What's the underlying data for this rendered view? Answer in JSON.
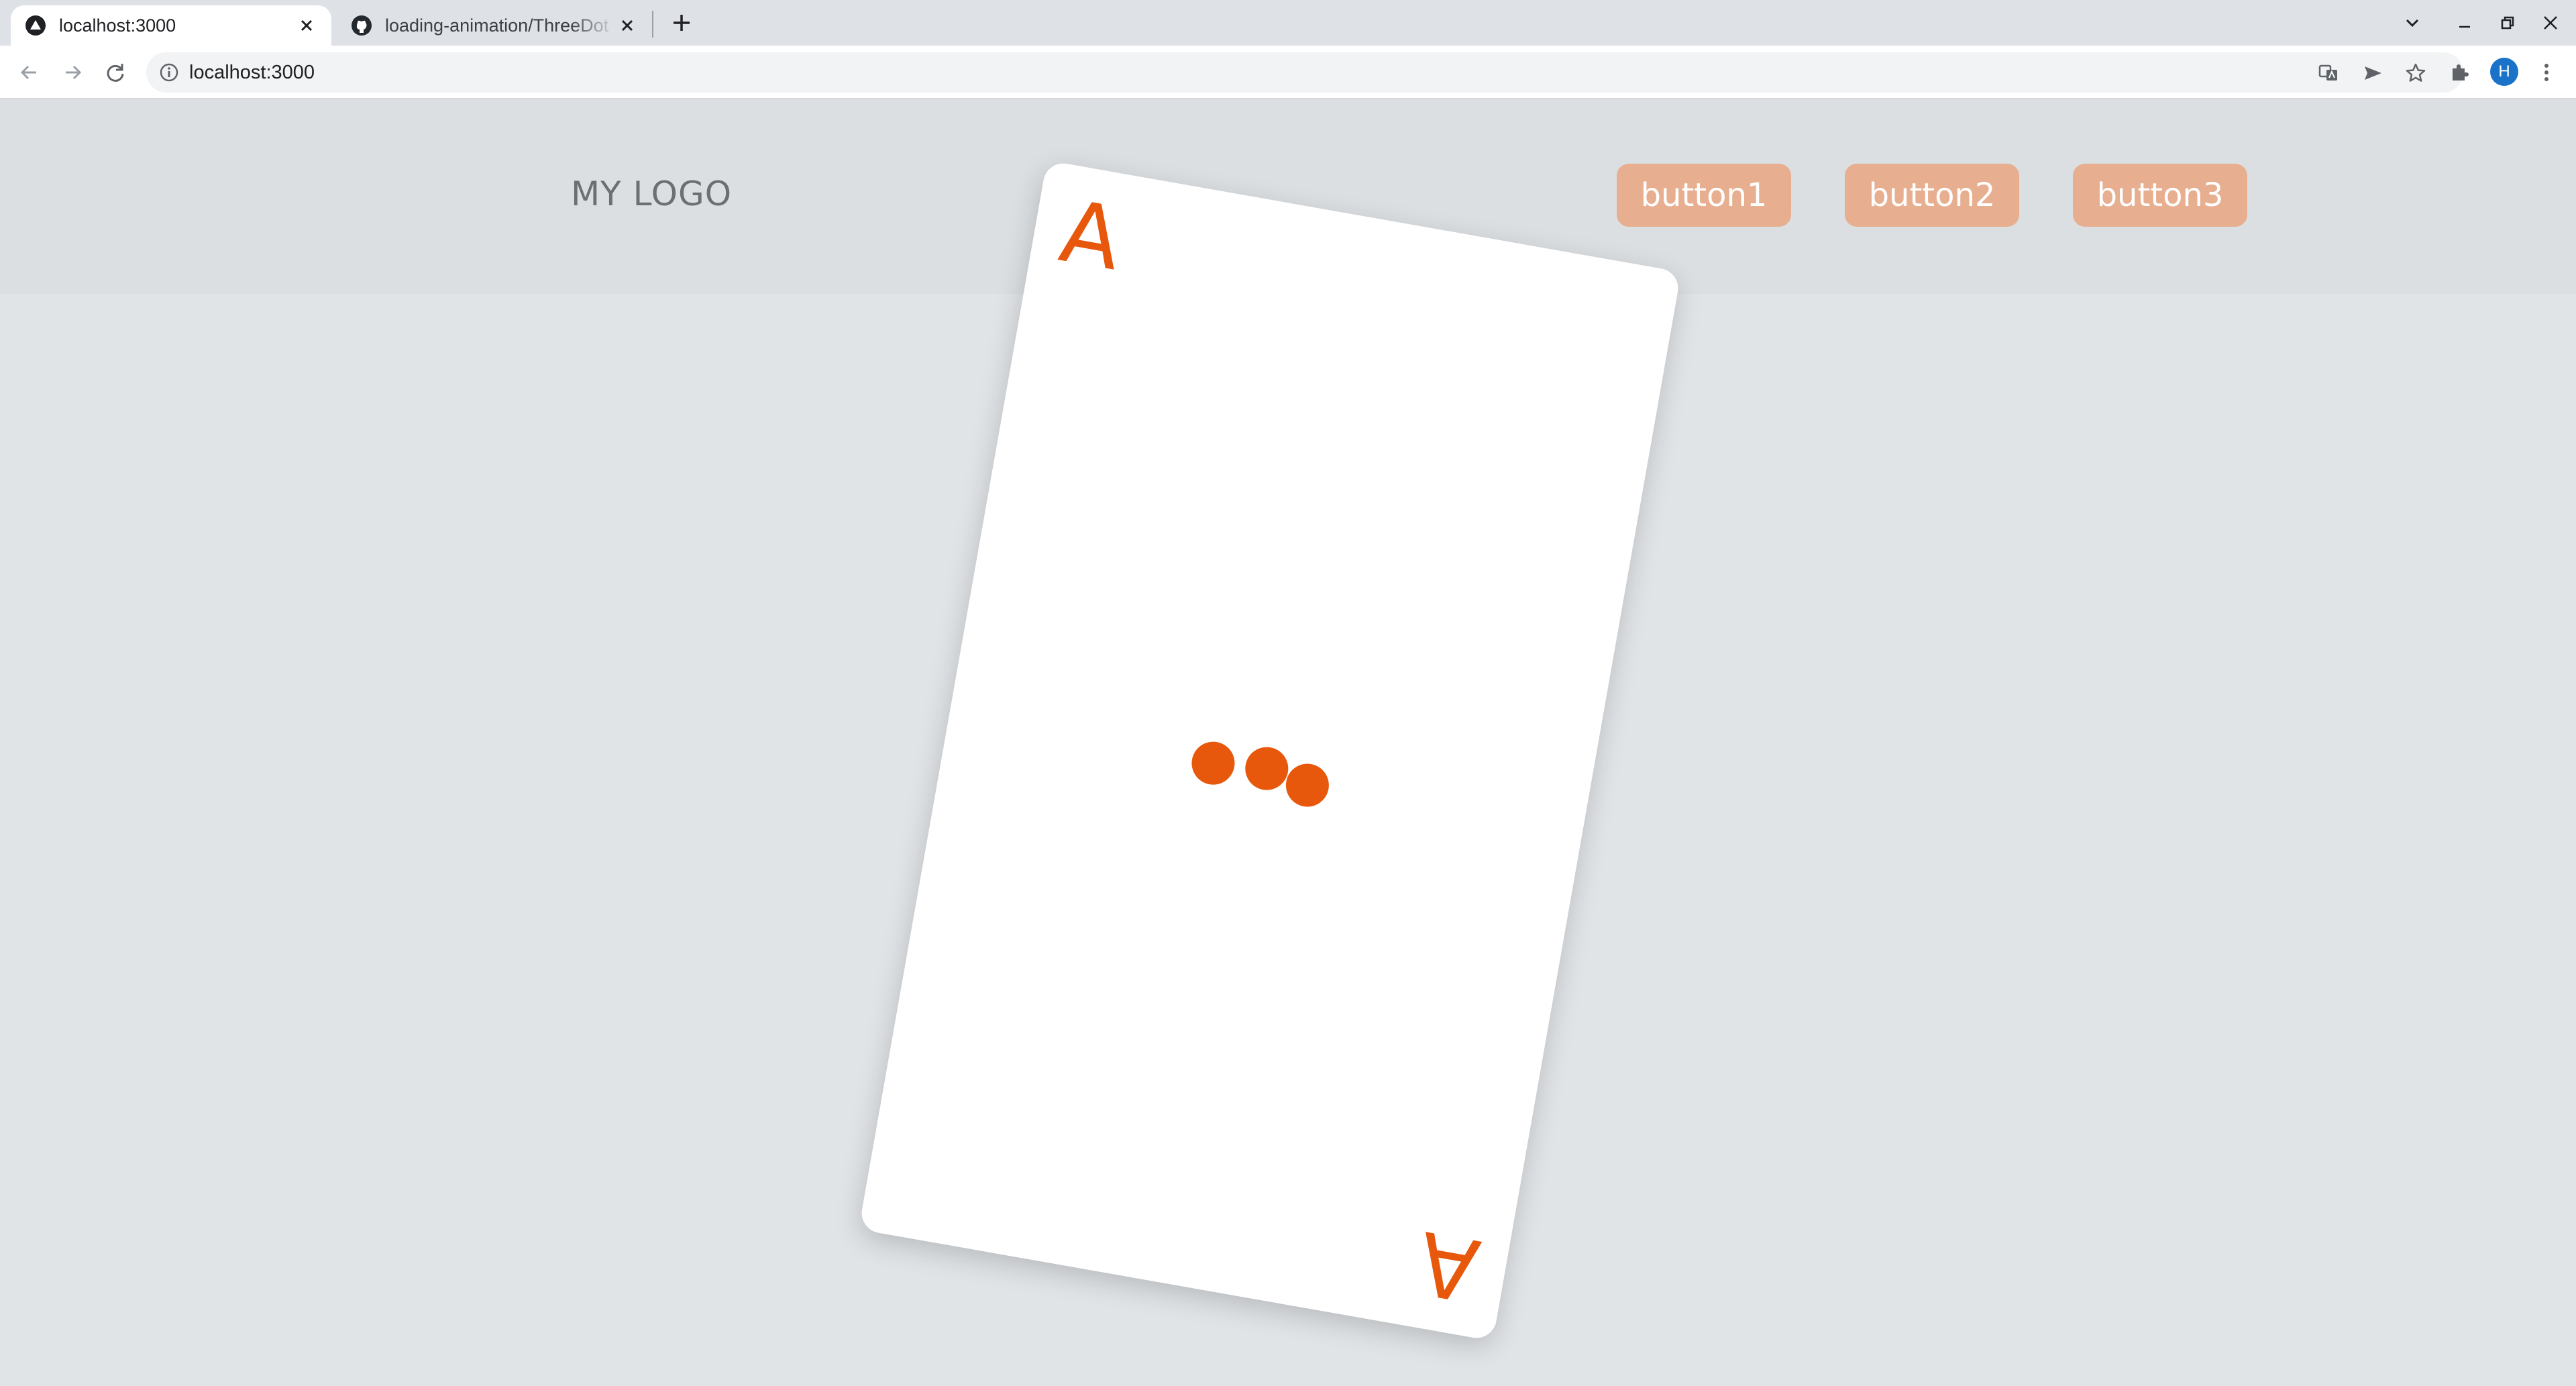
{
  "browser": {
    "tabs": [
      {
        "title": "localhost:3000",
        "active": true,
        "favicon": "nextjs-triangle-icon"
      },
      {
        "title": "loading-animation/ThreeDot",
        "active": false,
        "favicon": "github-icon"
      }
    ],
    "address": "localhost:3000",
    "profile_initial": "H"
  },
  "site": {
    "logo": "MY LOGO",
    "buttons": [
      "button1",
      "button2",
      "button3"
    ],
    "accent": "#e8580c",
    "button_color": "#e7ae8f"
  },
  "card": {
    "rank_top": "A",
    "rank_bottom": "A",
    "loader": "three-dot"
  }
}
